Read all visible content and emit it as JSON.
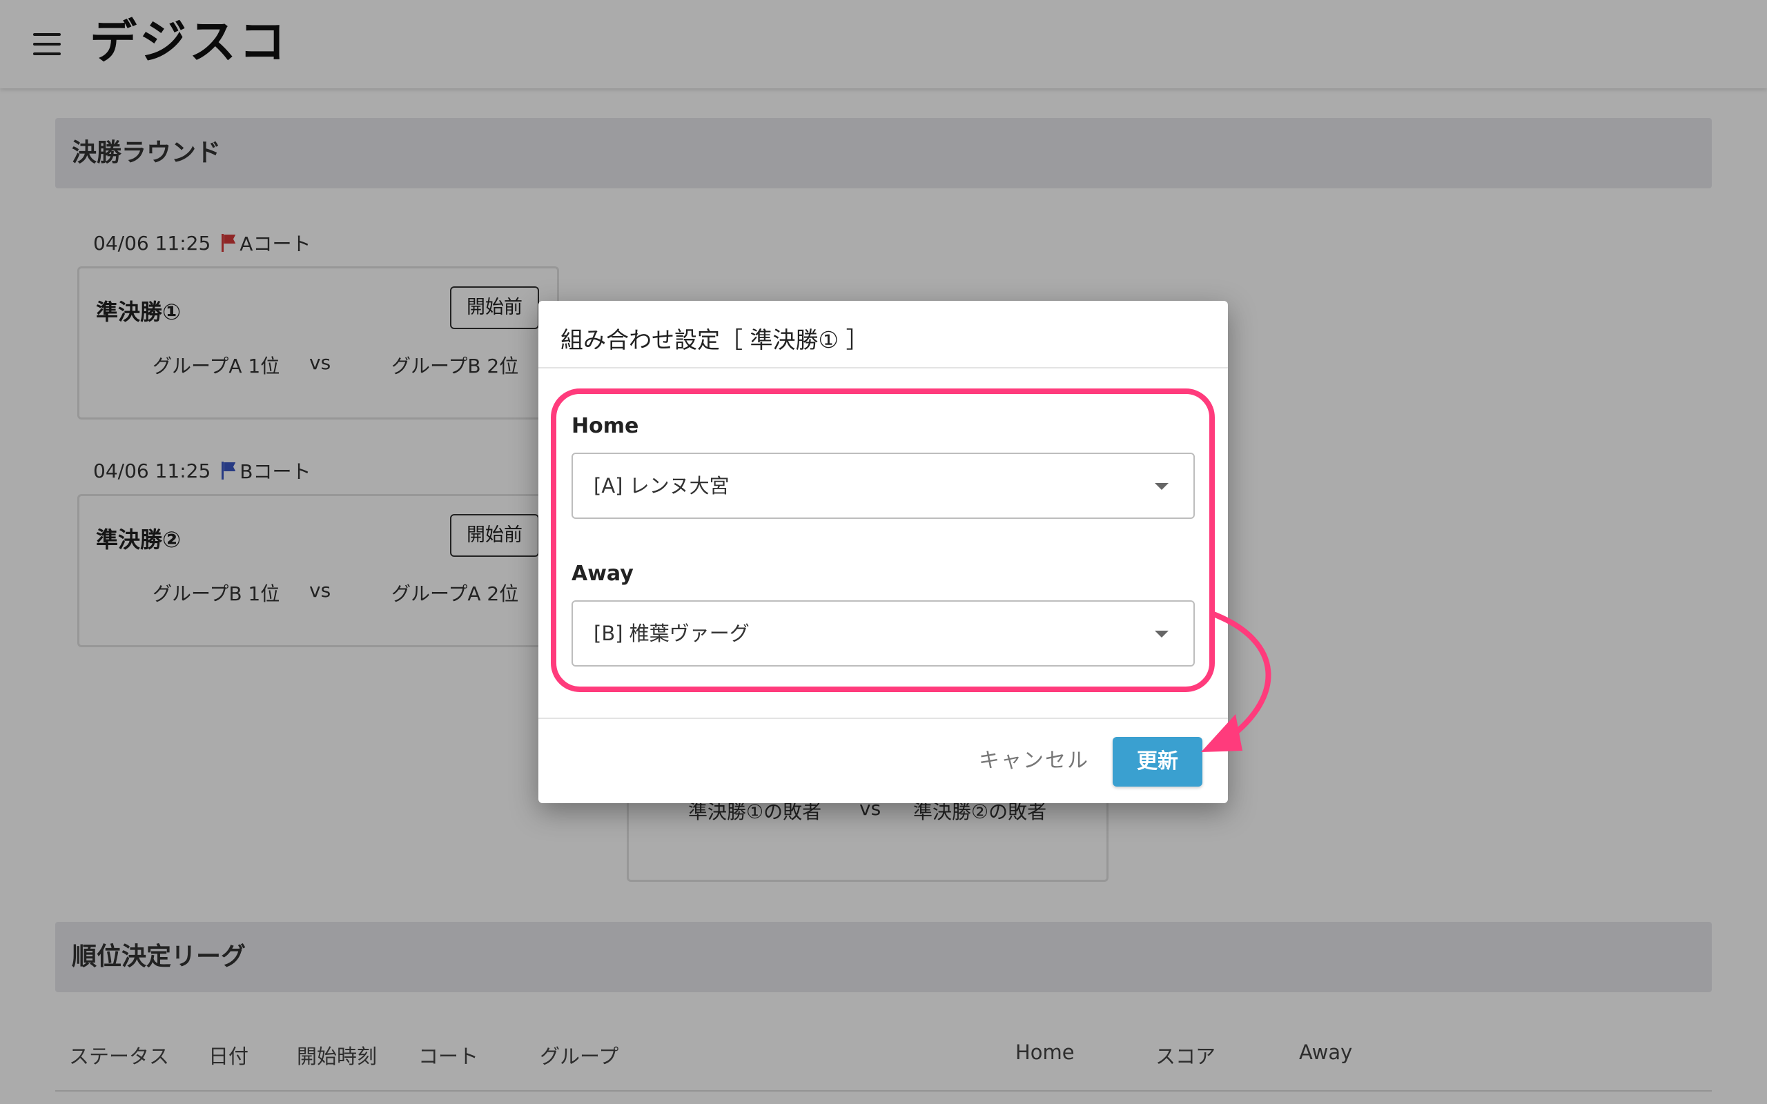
{
  "header": {
    "logo_text": "デジスコ"
  },
  "final_round": {
    "title": "決勝ラウンド",
    "matches": [
      {
        "date": "04/06 11:25",
        "court": "Aコート",
        "name": "準決勝①",
        "status": "開始前",
        "home": "グループA 1位",
        "vs": "vs",
        "away": "グループB 2位"
      },
      {
        "date": "04/06 11:25",
        "court": "Bコート",
        "name": "準決勝②",
        "status": "開始前",
        "home": "グループB 1位",
        "vs": "vs",
        "away": "グループA 2位"
      }
    ],
    "third_place": {
      "home": "準決勝①の敗者",
      "vs": "vs",
      "away": "準決勝②の敗者"
    }
  },
  "ranking_league": {
    "title": "順位決定リーグ",
    "columns": [
      "ステータス",
      "日付",
      "開始時刻",
      "コート",
      "グループ",
      "Home",
      "スコア",
      "Away"
    ]
  },
  "dialog": {
    "title": "組み合わせ設定［ 準決勝① ］",
    "home_label": "Home",
    "home_value": "[A] レンヌ大宮",
    "away_label": "Away",
    "away_value": "[B] 椎葉ヴァーグ",
    "cancel_label": "キャンセル",
    "update_label": "更新"
  },
  "colors": {
    "annotation": "#ff3b7c",
    "primary_button": "#3aa0d0",
    "logo_accent": "#e8364a",
    "flag_a": "#d63a3a",
    "flag_b": "#3b57c4"
  }
}
